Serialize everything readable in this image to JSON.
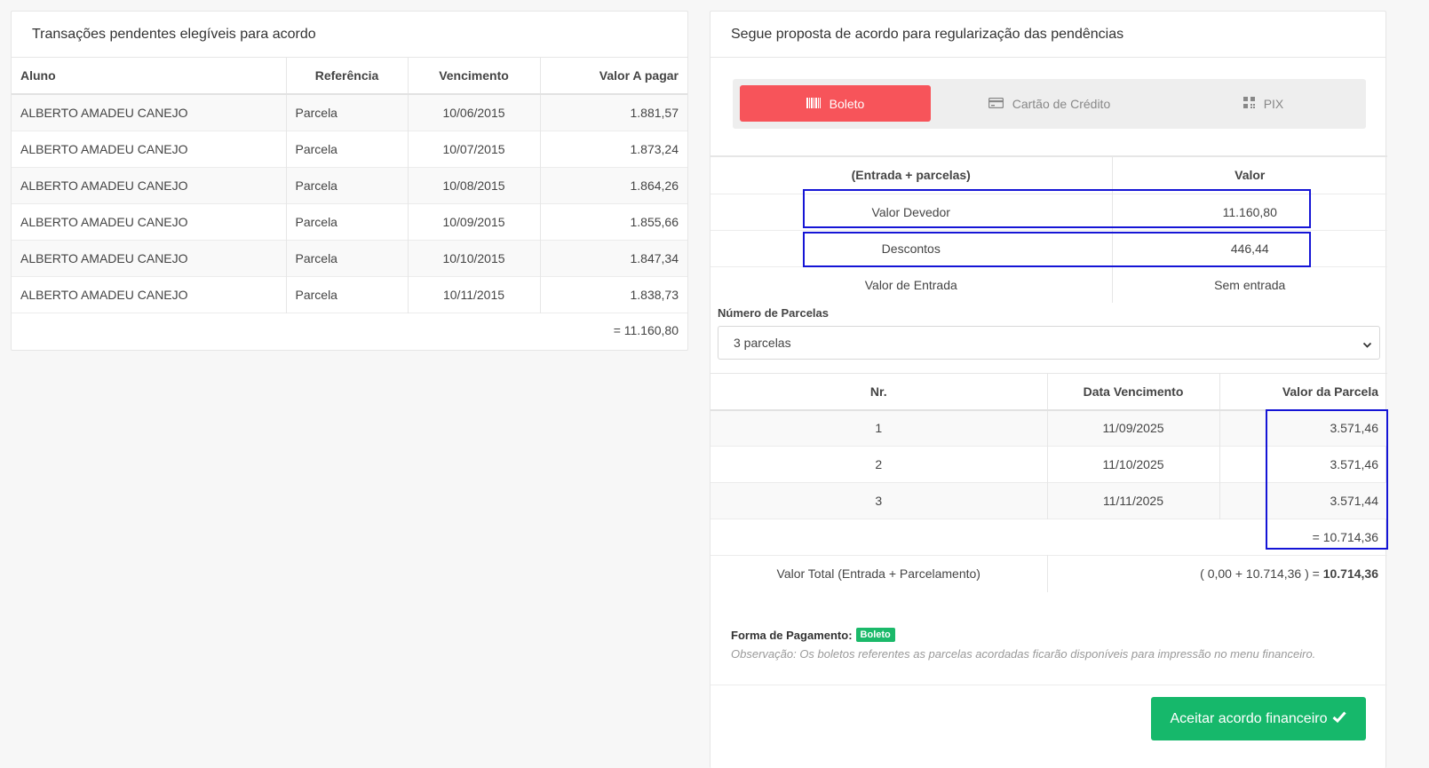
{
  "left": {
    "title": "Transações pendentes elegíveis para acordo",
    "columns": [
      "Aluno",
      "Referência",
      "Vencimento",
      "Valor A pagar"
    ],
    "rows": [
      [
        "ALBERTO AMADEU CANEJO",
        "Parcela",
        "10/06/2015",
        "1.881,57"
      ],
      [
        "ALBERTO AMADEU CANEJO",
        "Parcela",
        "10/07/2015",
        "1.873,24"
      ],
      [
        "ALBERTO AMADEU CANEJO",
        "Parcela",
        "10/08/2015",
        "1.864,26"
      ],
      [
        "ALBERTO AMADEU CANEJO",
        "Parcela",
        "10/09/2015",
        "1.855,66"
      ],
      [
        "ALBERTO AMADEU CANEJO",
        "Parcela",
        "10/10/2015",
        "1.847,34"
      ],
      [
        "ALBERTO AMADEU CANEJO",
        "Parcela",
        "10/11/2015",
        "1.838,73"
      ]
    ],
    "total": "= 11.160,80"
  },
  "right": {
    "title": "Segue proposta de acordo para regularização das pendências",
    "tabs": [
      {
        "label": "Boleto",
        "icon": "barcode-icon",
        "active": true
      },
      {
        "label": "Cartão de Crédito",
        "icon": "credit-card-icon",
        "active": false
      },
      {
        "label": "PIX",
        "icon": "qr-code-icon",
        "active": false
      }
    ],
    "summary": {
      "col1": "(Entrada + parcelas)",
      "col2": "Valor",
      "rows": [
        [
          "Valor Devedor",
          "11.160,80"
        ],
        [
          "Descontos",
          "446,44"
        ],
        [
          "Valor de Entrada",
          "Sem entrada"
        ]
      ]
    },
    "parcelas_label": "Número de Parcelas",
    "parcelas_selected": "3 parcelas",
    "installments": {
      "columns": [
        "Nr.",
        "Data Vencimento",
        "Valor da Parcela"
      ],
      "rows": [
        [
          "1",
          "11/09/2025",
          "3.571,46"
        ],
        [
          "2",
          "11/10/2025",
          "3.571,46"
        ],
        [
          "3",
          "11/11/2025",
          "3.571,44"
        ]
      ],
      "subtotal": "= 10.714,36",
      "total_label": "Valor Total (Entrada + Parcelamento)",
      "total_expr": "( 0,00 + 10.714,36 ) = ",
      "total_value": "10.714,36"
    },
    "forma_label": "Forma de Pagamento:",
    "forma_value": "Boleto",
    "observacao": "Observação: Os boletos referentes as parcelas acordadas ficarão disponíveis para impressão no menu financeiro.",
    "accept_label": "Aceitar acordo financeiro"
  },
  "colors": {
    "accent_red": "#f7545a",
    "accent_green": "#16b86b",
    "highlight_blue": "#1515d6"
  }
}
